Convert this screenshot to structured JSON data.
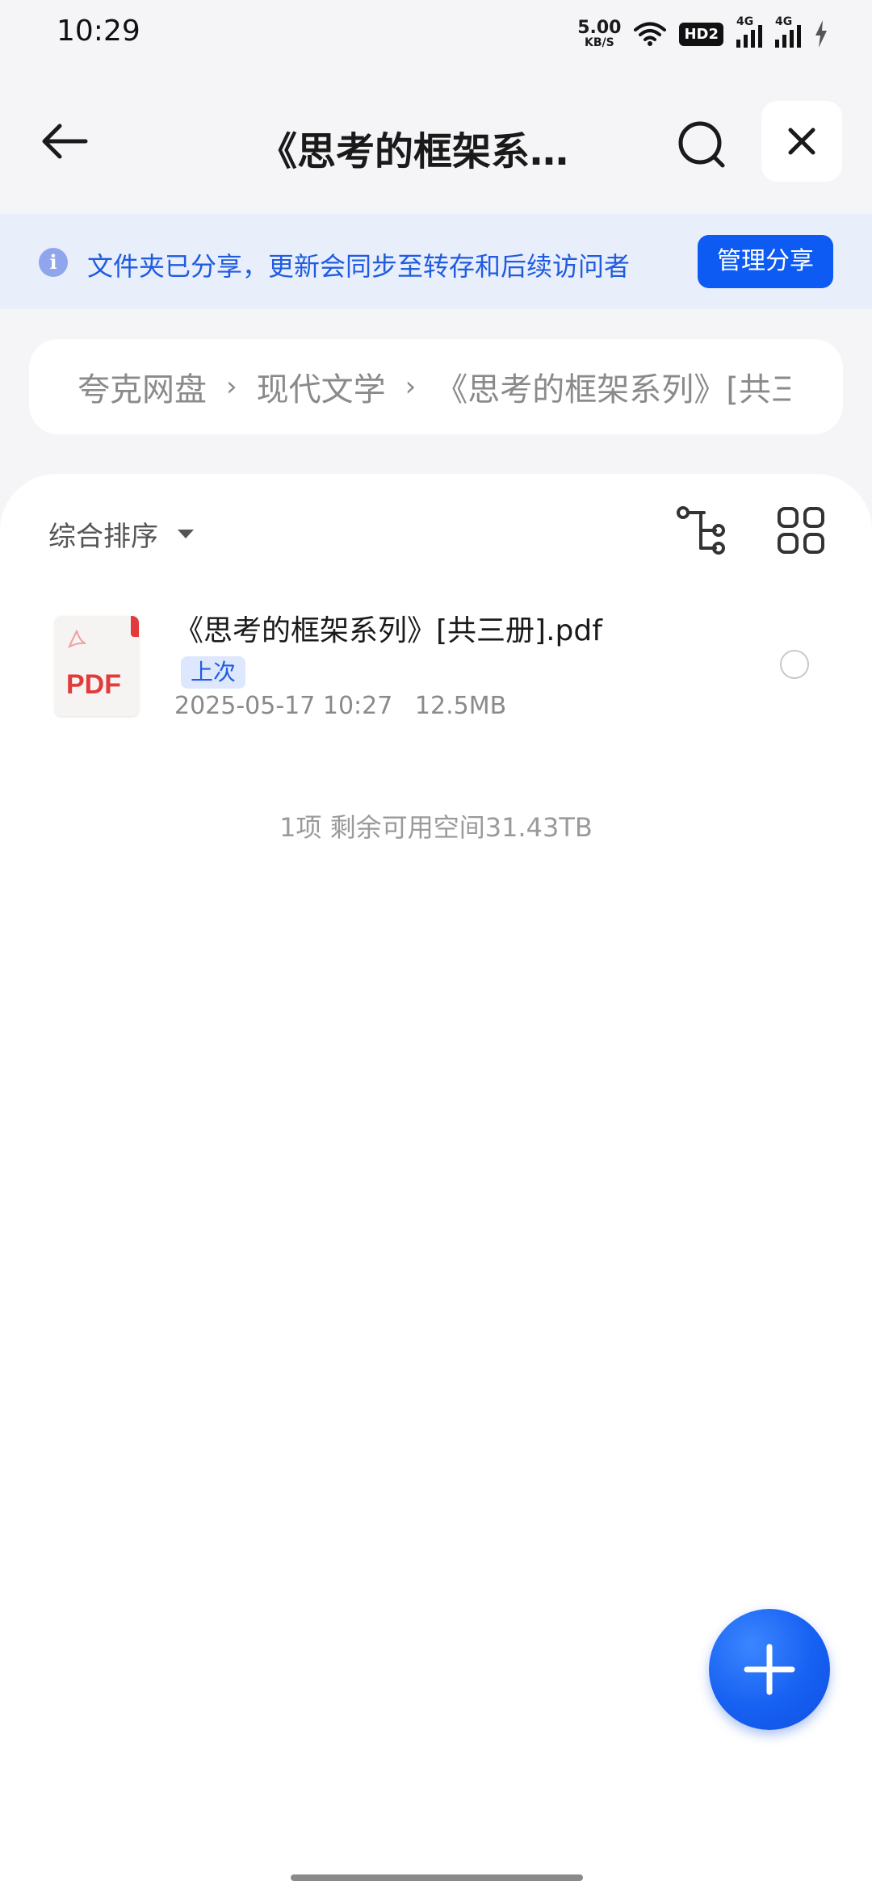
{
  "status_bar": {
    "time": "10:29",
    "speed_value": "5.00",
    "speed_unit": "KB/S",
    "hd_label": "HD2",
    "signal1_label": "4G",
    "signal2_label": "4G"
  },
  "header": {
    "title": "《思考的框架系列…"
  },
  "share_banner": {
    "text": "文件夹已分享，更新会同步至转存和后续访问者",
    "button": "管理分享"
  },
  "breadcrumb": {
    "items": [
      "夸克网盘",
      "现代文学",
      "《思考的框架系列》[共三"
    ]
  },
  "toolbar": {
    "sort_label": "综合排序"
  },
  "files": [
    {
      "name": "《思考的框架系列》[共三册].pdf",
      "tag": "上次",
      "date": "2025-05-17 10:27",
      "size": "12.5MB",
      "icon_label": "PDF"
    }
  ],
  "footer": {
    "summary": "1项 剩余可用空间31.43TB"
  },
  "colors": {
    "accent": "#0d5bf2",
    "banner_bg": "#e9eefb",
    "pdf_red": "#e23b3b"
  }
}
